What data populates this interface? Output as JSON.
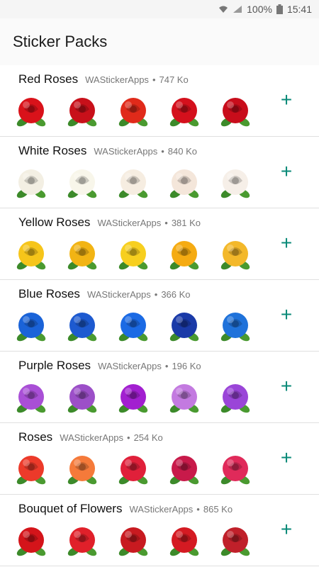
{
  "status_bar": {
    "battery": "100%",
    "time": "15:41",
    "icons": [
      "wifi-icon",
      "signal-icon",
      "battery-icon"
    ]
  },
  "app_bar": {
    "title": "Sticker Packs"
  },
  "packs": [
    {
      "name": "Red Roses",
      "publisher": "WAStickerApps",
      "size": "747 Ko",
      "colors": [
        "#d9121a",
        "#c8101a",
        "#e02a1a",
        "#d4101c",
        "#c80d1b"
      ],
      "add_icon": "add-icon"
    },
    {
      "name": "White Roses",
      "publisher": "WAStickerApps",
      "size": "840 Ko",
      "colors": [
        "#f3efe3",
        "#f8f6ea",
        "#f6ede1",
        "#f4e6da",
        "#f6efe8"
      ],
      "add_icon": "add-icon"
    },
    {
      "name": "Yellow Roses",
      "publisher": "WAStickerApps",
      "size": "381 Ko",
      "colors": [
        "#f6c51a",
        "#f2b414",
        "#f7cf1f",
        "#f5ab12",
        "#f3b82a"
      ],
      "add_icon": "add-icon"
    },
    {
      "name": "Blue Roses",
      "publisher": "WAStickerApps",
      "size": "366 Ko",
      "colors": [
        "#1a63d8",
        "#1d5ad0",
        "#1b6ae4",
        "#1a3aa8",
        "#1f72da"
      ],
      "add_icon": "add-icon"
    },
    {
      "name": "Purple Roses",
      "publisher": "WAStickerApps",
      "size": "196 Ko",
      "colors": [
        "#a94fd6",
        "#9c4fc8",
        "#a21fd0",
        "#c37ae0",
        "#9a45d8"
      ],
      "add_icon": "add-icon"
    },
    {
      "name": "Roses",
      "publisher": "WAStickerApps",
      "size": "254 Ko",
      "colors": [
        "#ec3a2a",
        "#f57a3a",
        "#e0203a",
        "#c81a4a",
        "#e02a5a"
      ],
      "add_icon": "add-icon"
    },
    {
      "name": "Bouquet of Flowers",
      "publisher": "WAStickerApps",
      "size": "865 Ko",
      "colors": [
        "#d4141a",
        "#e0202a",
        "#c81a20",
        "#d41a22",
        "#c0202a"
      ],
      "add_icon": "add-icon"
    }
  ],
  "add_symbol": "+"
}
